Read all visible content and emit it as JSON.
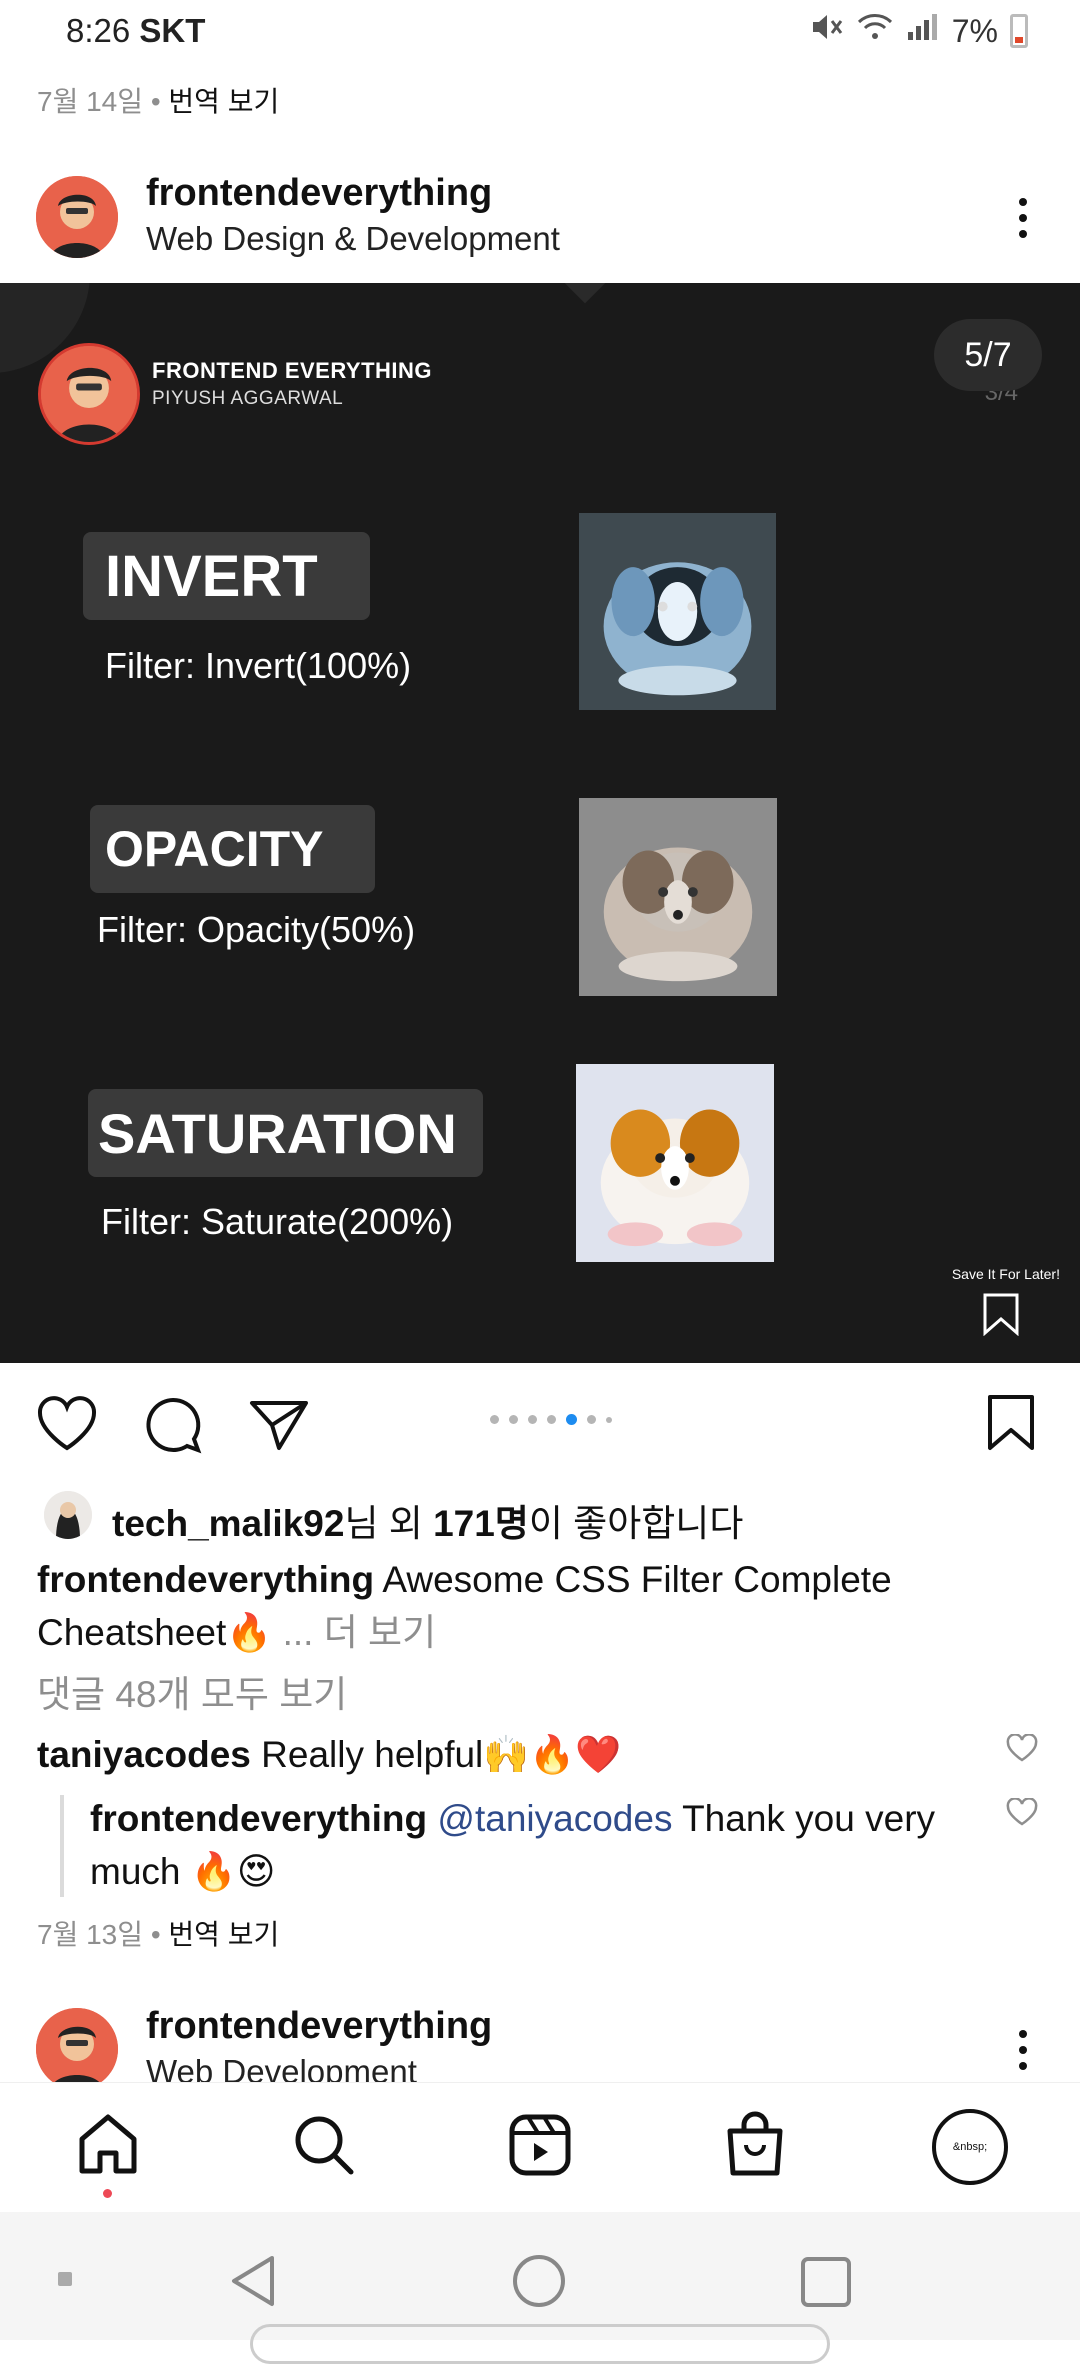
{
  "status": {
    "time": "8:26",
    "carrier": "SKT",
    "battery": "7%"
  },
  "top_meta": {
    "date": "7월 14일",
    "sep": "•",
    "translate": "번역 보기"
  },
  "post": {
    "username": "frontendeverything",
    "subtitle": "Web Design & Development"
  },
  "slide": {
    "brand": "FRONTEND EVERYTHING",
    "author": "PIYUSH AGGARWAL",
    "counter": "5/7",
    "counter_ghost": "3/4",
    "filters": [
      {
        "title": "INVERT",
        "desc": "Filter: Invert(100%)"
      },
      {
        "title": "OPACITY",
        "desc": "Filter: Opacity(50%)"
      },
      {
        "title": "SATURATION",
        "desc": "Filter: Saturate(200%)"
      }
    ],
    "save_later": "Save It For Later!"
  },
  "carousel": {
    "total": 7,
    "active_index": 4
  },
  "likes": {
    "user": "tech_malik92",
    "mid": "님 외 ",
    "count": "171명",
    "suffix": "이 좋아합니다"
  },
  "caption": {
    "user": "frontendeverything",
    "text": " Awesome CSS Filter Complete Cheatsheet",
    "emoji": "🔥",
    "more_ellipsis": " ... ",
    "more": "더 보기"
  },
  "view_comments": "댓글 48개 모두 보기",
  "comments": [
    {
      "user": "taniyacodes",
      "text": " Really helpful",
      "emoji": "🙌🔥❤️"
    },
    {
      "user": "frontendeverything",
      "mention": " @taniyacodes",
      "text": " Thank you very much ",
      "emoji": "🔥😍"
    }
  ],
  "comment_meta": {
    "date": "7월 13일",
    "sep": "•",
    "translate": "번역 보기"
  },
  "next_post": {
    "username": "frontendeverything",
    "subtitle": "Web Development"
  },
  "profile_placeholder": "&nbsp;",
  "colors": {
    "accent_blue": "#1d8cf0",
    "slide_bg": "#1a1a1a",
    "notif_red": "#ed4956"
  }
}
